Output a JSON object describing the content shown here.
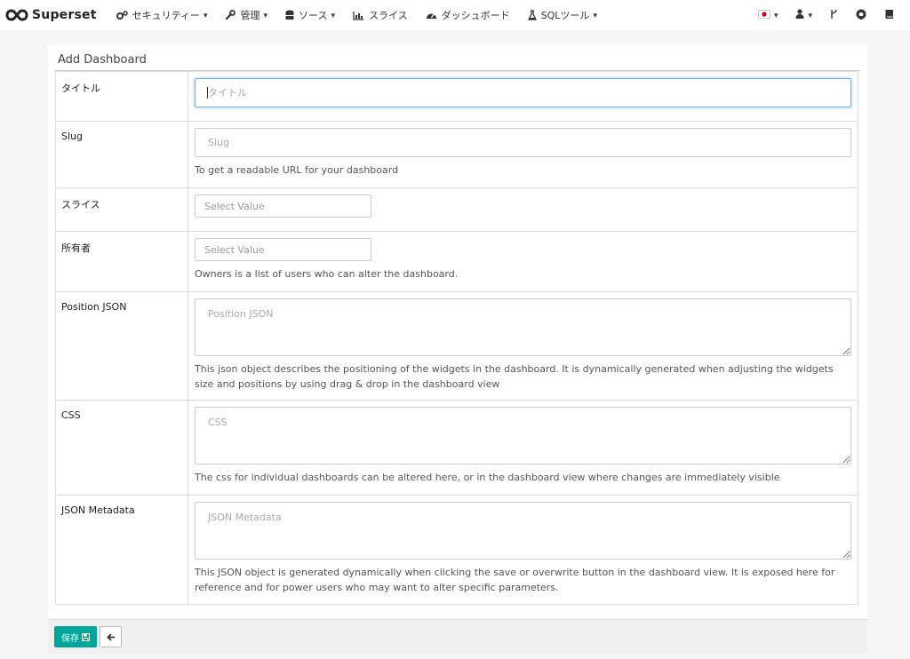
{
  "navbar": {
    "brand": "Superset",
    "items": [
      {
        "label": "セキュリティー",
        "icon": "gears-icon",
        "dropdown": true
      },
      {
        "label": "管理",
        "icon": "wrench-icon",
        "dropdown": true
      },
      {
        "label": "ソース",
        "icon": "database-icon",
        "dropdown": true
      },
      {
        "label": "スライス",
        "icon": "bar-chart-icon",
        "dropdown": false
      },
      {
        "label": "ダッシュボード",
        "icon": "dashboard-icon",
        "dropdown": false
      },
      {
        "label": "SQLツール",
        "icon": "flask-icon",
        "dropdown": true
      }
    ],
    "right_icons": [
      "japan-flag-icon",
      "user-icon",
      "code-fork-icon",
      "github-icon",
      "book-icon"
    ]
  },
  "panel": {
    "title": "Add Dashboard"
  },
  "form": {
    "title": {
      "label": "タイトル",
      "placeholder": "タイトル"
    },
    "slug": {
      "label": "Slug",
      "placeholder": "Slug",
      "help": "To get a readable URL for your dashboard"
    },
    "slices": {
      "label": "スライス",
      "placeholder": "Select Value"
    },
    "owners": {
      "label": "所有者",
      "placeholder": "Select Value",
      "help": "Owners is a list of users who can alter the dashboard."
    },
    "position_json": {
      "label": "Position JSON",
      "placeholder": "Position JSON",
      "help": "This json object describes the positioning of the widgets in the dashboard. It is dynamically generated when adjusting the widgets size and positions by using drag & drop in the dashboard view"
    },
    "css": {
      "label": "CSS",
      "placeholder": "CSS",
      "help": "The css for individual dashboards can be altered here, or in the dashboard view where changes are immediately visible"
    },
    "json_metadata": {
      "label": "JSON Metadata",
      "placeholder": "JSON Metadata",
      "help": "This JSON object is generated dynamically when clicking the save or overwrite button in the dashboard view. It is exposed here for reference and for power users who may want to alter specific parameters."
    }
  },
  "footer": {
    "save_label": "保存",
    "save_color": "#00a699"
  }
}
